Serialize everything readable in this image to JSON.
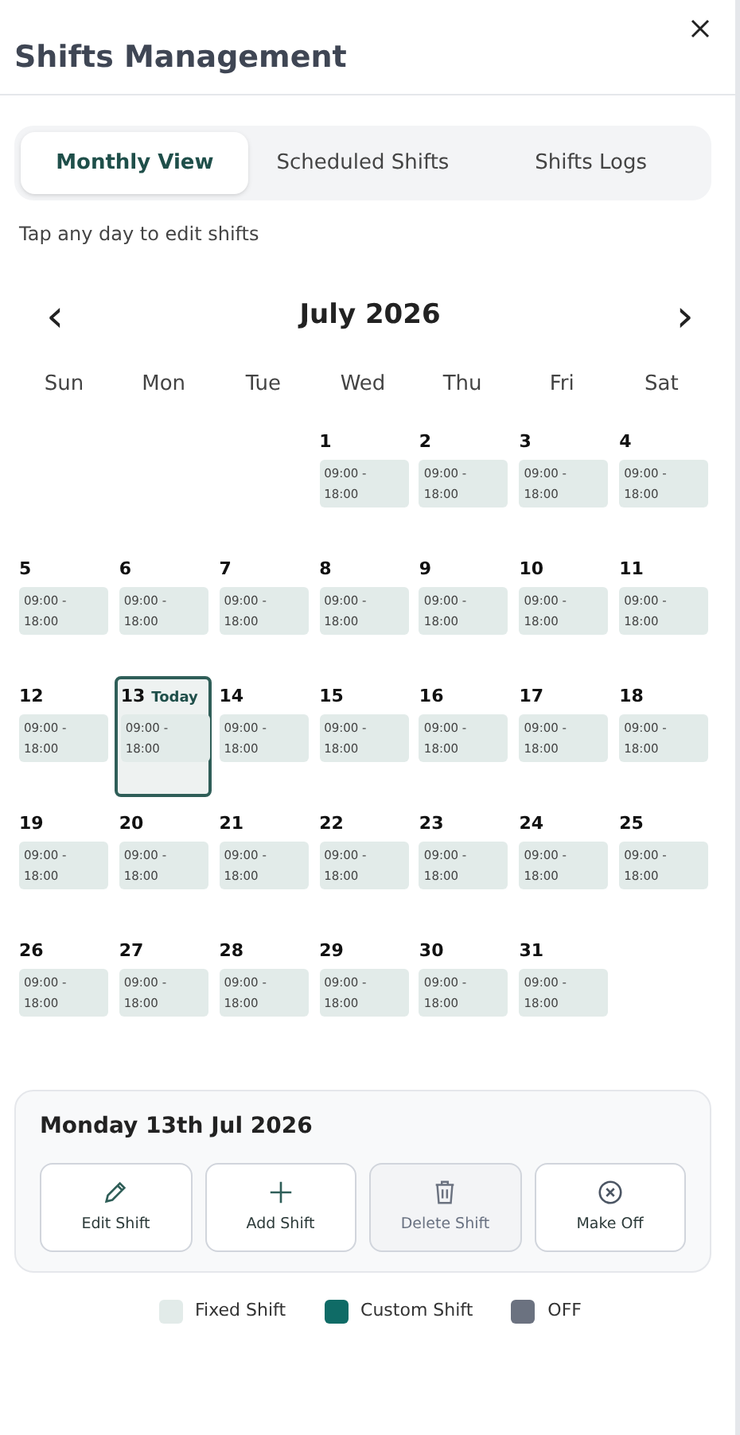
{
  "title": "Shifts Management",
  "tabs": [
    {
      "label": "Monthly View",
      "selected": true
    },
    {
      "label": "Scheduled Shifts",
      "selected": false
    },
    {
      "label": "Shifts Logs",
      "selected": false
    }
  ],
  "hint": "Tap any day to edit shifts",
  "calendar": {
    "prev": "‹",
    "next": "›",
    "month": "July 2026",
    "weekdays": [
      "Sun",
      "Mon",
      "Tue",
      "Wed",
      "Thu",
      "Fri",
      "Sat"
    ],
    "weeks": [
      [
        {
          "kind": "empty"
        },
        {
          "kind": "empty"
        },
        {
          "kind": "empty"
        },
        {
          "day": "1",
          "shift": "09:00 - 18:00",
          "kind": "fixed",
          "selected": false
        },
        {
          "day": "2",
          "shift": "09:00 - 18:00",
          "kind": "fixed",
          "selected": false
        },
        {
          "day": "3",
          "shift": "09:00 - 18:00",
          "kind": "fixed",
          "selected": false
        },
        {
          "day": "4",
          "shift": "09:00 - 18:00",
          "kind": "fixed",
          "selected": false
        }
      ],
      [
        {
          "day": "5",
          "shift": "09:00 - 18:00",
          "kind": "fixed",
          "selected": false
        },
        {
          "day": "6",
          "shift": "09:00 - 18:00",
          "kind": "fixed",
          "selected": false
        },
        {
          "day": "7",
          "shift": "09:00 - 18:00",
          "kind": "fixed",
          "selected": false
        },
        {
          "day": "8",
          "shift": "09:00 - 18:00",
          "kind": "fixed",
          "selected": false
        },
        {
          "day": "9",
          "shift": "09:00 - 18:00",
          "kind": "fixed",
          "selected": false
        },
        {
          "day": "10",
          "shift": "09:00 - 18:00",
          "kind": "fixed",
          "selected": false
        },
        {
          "day": "11",
          "shift": "09:00 - 18:00",
          "kind": "fixed",
          "selected": false
        }
      ],
      [
        {
          "day": "12",
          "shift": "09:00 - 18:00",
          "kind": "fixed",
          "selected": false
        },
        {
          "day": "13",
          "today": "Today",
          "shift": "09:00 - 18:00",
          "kind": "fixed",
          "selected": true
        },
        {
          "day": "14",
          "shift": "09:00 - 18:00",
          "kind": "fixed",
          "selected": false
        },
        {
          "day": "15",
          "shift": "09:00 - 18:00",
          "kind": "fixed",
          "selected": false
        },
        {
          "day": "16",
          "shift": "09:00 - 18:00",
          "kind": "fixed",
          "selected": false
        },
        {
          "day": "17",
          "shift": "09:00 - 18:00",
          "kind": "fixed",
          "selected": false
        },
        {
          "day": "18",
          "shift": "09:00 - 18:00",
          "kind": "fixed",
          "selected": false
        }
      ],
      [
        {
          "day": "19",
          "shift": "09:00 - 18:00",
          "kind": "fixed",
          "selected": false
        },
        {
          "day": "20",
          "shift": "09:00 - 18:00",
          "kind": "fixed",
          "selected": false
        },
        {
          "day": "21",
          "shift": "09:00 - 18:00",
          "kind": "fixed",
          "selected": false
        },
        {
          "day": "22",
          "shift": "09:00 - 18:00",
          "kind": "fixed",
          "selected": false
        },
        {
          "day": "23",
          "shift": "09:00 - 18:00",
          "kind": "fixed",
          "selected": false
        },
        {
          "day": "24",
          "shift": "09:00 - 18:00",
          "kind": "fixed",
          "selected": false
        },
        {
          "day": "25",
          "shift": "09:00 - 18:00",
          "kind": "fixed",
          "selected": false
        }
      ],
      [
        {
          "day": "26",
          "shift": "09:00 - 18:00",
          "kind": "fixed",
          "selected": false
        },
        {
          "day": "27",
          "shift": "09:00 - 18:00",
          "kind": "fixed",
          "selected": false
        },
        {
          "day": "28",
          "shift": "09:00 - 18:00",
          "kind": "fixed",
          "selected": false
        },
        {
          "day": "29",
          "shift": "09:00 - 18:00",
          "kind": "fixed",
          "selected": false
        },
        {
          "day": "30",
          "shift": "09:00 - 18:00",
          "kind": "fixed",
          "selected": false
        },
        {
          "day": "31",
          "shift": "09:00 - 18:00",
          "kind": "fixed",
          "selected": false
        },
        {
          "kind": "empty"
        }
      ]
    ]
  },
  "detail": {
    "date": "Monday 13th Jul 2026",
    "actions": [
      {
        "kind": "edit",
        "label": "Edit Shift",
        "disabled": false
      },
      {
        "kind": "add",
        "label": "Add Shift",
        "disabled": false
      },
      {
        "kind": "delete",
        "label": "Delete Shift",
        "disabled": true
      },
      {
        "kind": "off",
        "label": "Make Off",
        "disabled": false
      }
    ]
  },
  "legend": [
    {
      "kind": "fixed",
      "label": "Fixed Shift",
      "color": "#e2ebe9"
    },
    {
      "kind": "custom",
      "label": "Custom Shift",
      "color": "#0f6b66"
    },
    {
      "kind": "off",
      "label": "OFF",
      "color": "#6b7280"
    }
  ]
}
